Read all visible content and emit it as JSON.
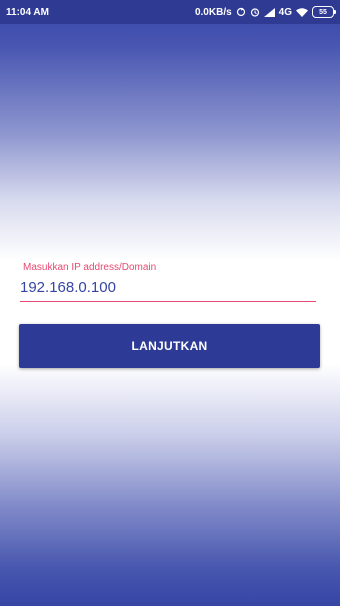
{
  "status_bar": {
    "time": "11:04 AM",
    "network_speed": "0.0KB/s",
    "signal_type": "4G",
    "battery": "55",
    "icons": [
      "sync-icon",
      "alarm-icon",
      "signal-icon",
      "wifi-icon",
      "battery-icon"
    ]
  },
  "form": {
    "label": "Masukkan IP address/Domain",
    "value": "192.168.0.100"
  },
  "button": {
    "label": "LANJUTKAN"
  },
  "colors": {
    "accent": "#e64a72",
    "primary": "#2e3b96",
    "text_value": "#3645a4"
  }
}
